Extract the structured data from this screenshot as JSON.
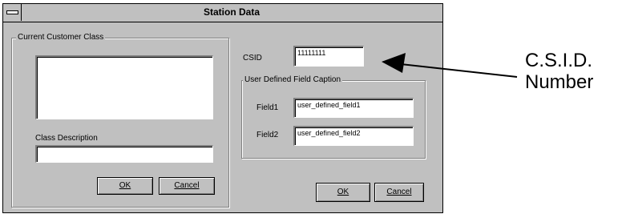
{
  "window": {
    "title": "Station Data"
  },
  "customer_class": {
    "group_label": "Current Customer Class",
    "list_items": [],
    "description_label": "Class Description",
    "description_value": "",
    "ok_label": "OK",
    "cancel_label": "Cancel"
  },
  "csid": {
    "label": "CSID",
    "value": "11111111"
  },
  "user_defined": {
    "group_label": "User Defined Field Caption",
    "field1_label": "Field1",
    "field1_value": "user_defined_field1",
    "field2_label": "Field2",
    "field2_value": "user_defined_field2"
  },
  "dialog_buttons": {
    "ok_label": "OK",
    "cancel_label": "Cancel"
  },
  "annotation": {
    "line1": "C.S.I.D.",
    "line2": "Number"
  }
}
